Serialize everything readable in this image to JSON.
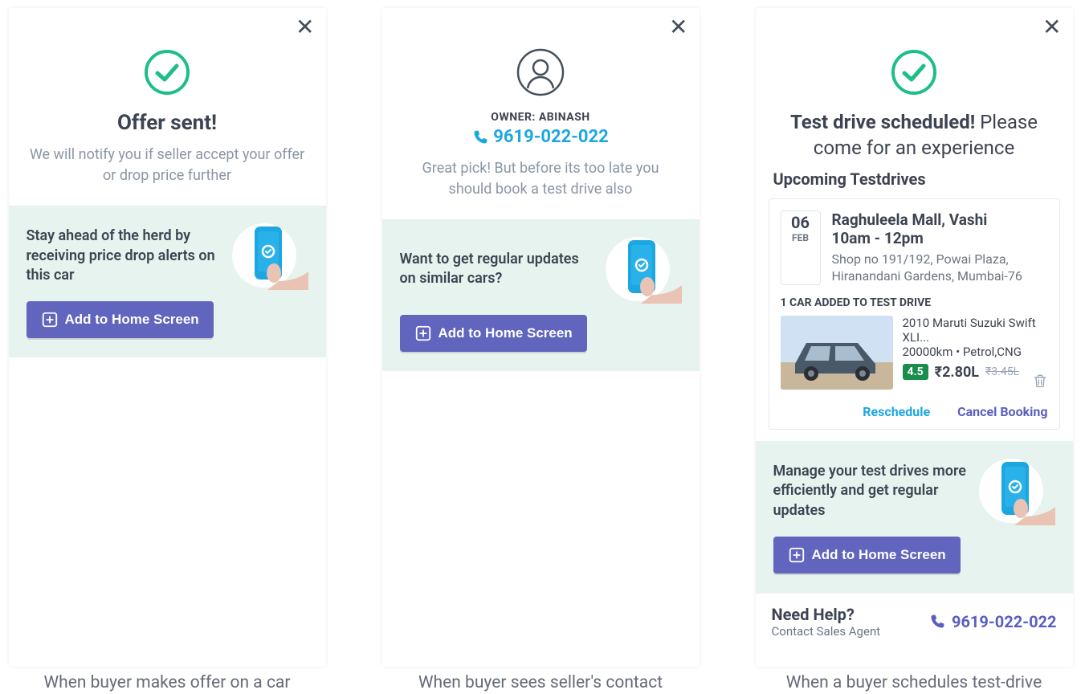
{
  "screen1": {
    "title": "Offer sent!",
    "subtitle": "We will notify you if seller accept your offer or drop price further",
    "promo_text": "Stay ahead of the herd by receiving price drop alerts on this car",
    "add_to_home": "Add to Home Screen",
    "caption": "When buyer makes offer on a car"
  },
  "screen2": {
    "owner_label": "OWNER: ABINASH",
    "owner_phone": "9619-022-022",
    "subtitle": "Great pick! But before its too late you should book a test drive also",
    "promo_text": "Want to get regular updates on similar cars?",
    "add_to_home": "Add to Home Screen",
    "caption": "When buyer sees seller's contact"
  },
  "screen3": {
    "title_strong": "Test drive scheduled!",
    "title_rest": " Please come for an experience",
    "upcoming_heading": "Upcoming Testdrives",
    "date_day": "06",
    "date_mon": "FEB",
    "location": "Raghuleela Mall, Vashi",
    "time": "10am - 12pm",
    "address": "Shop no 191/192, Powai Plaza, Hiranandani Gardens, Mumbai-76",
    "count_label": "1 CAR ADDED TO TEST DRIVE",
    "car_title": "2010 Maruti Suzuki Swift XLI...",
    "car_sub": "20000km • Petrol,CNG",
    "rating": "4.5",
    "price": "₹2.80L",
    "price_old": "₹3.45L",
    "reschedule": "Reschedule",
    "cancel": "Cancel Booking",
    "promo_text": "Manage your test drives more efficiently and get regular updates",
    "add_to_home": "Add to Home Screen",
    "need_help": "Need Help?",
    "contact_agent": "Contact Sales Agent",
    "help_phone": "9619-022-022",
    "caption": "When a buyer schedules test-drive"
  }
}
